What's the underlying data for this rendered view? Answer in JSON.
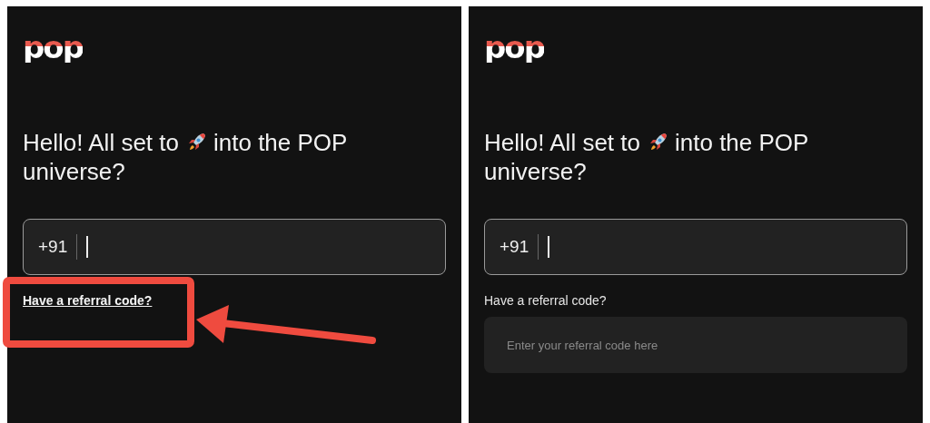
{
  "screens": [
    {
      "logo": "pop",
      "heading_start": "Hello! All set to",
      "heading_middle": "into the POP",
      "heading_end": "universe?",
      "phone": {
        "prefix": "+91"
      },
      "referral": {
        "label": "Have a referral code?",
        "expanded": false
      }
    },
    {
      "logo": "pop",
      "heading_start": "Hello! All set to",
      "heading_middle": "into the POP",
      "heading_end": "universe?",
      "phone": {
        "prefix": "+91"
      },
      "referral": {
        "label": "Have a referral code?",
        "expanded": true,
        "placeholder": "Enter your referral code here"
      }
    }
  ],
  "callout": {
    "color": "#ef4b3f"
  }
}
